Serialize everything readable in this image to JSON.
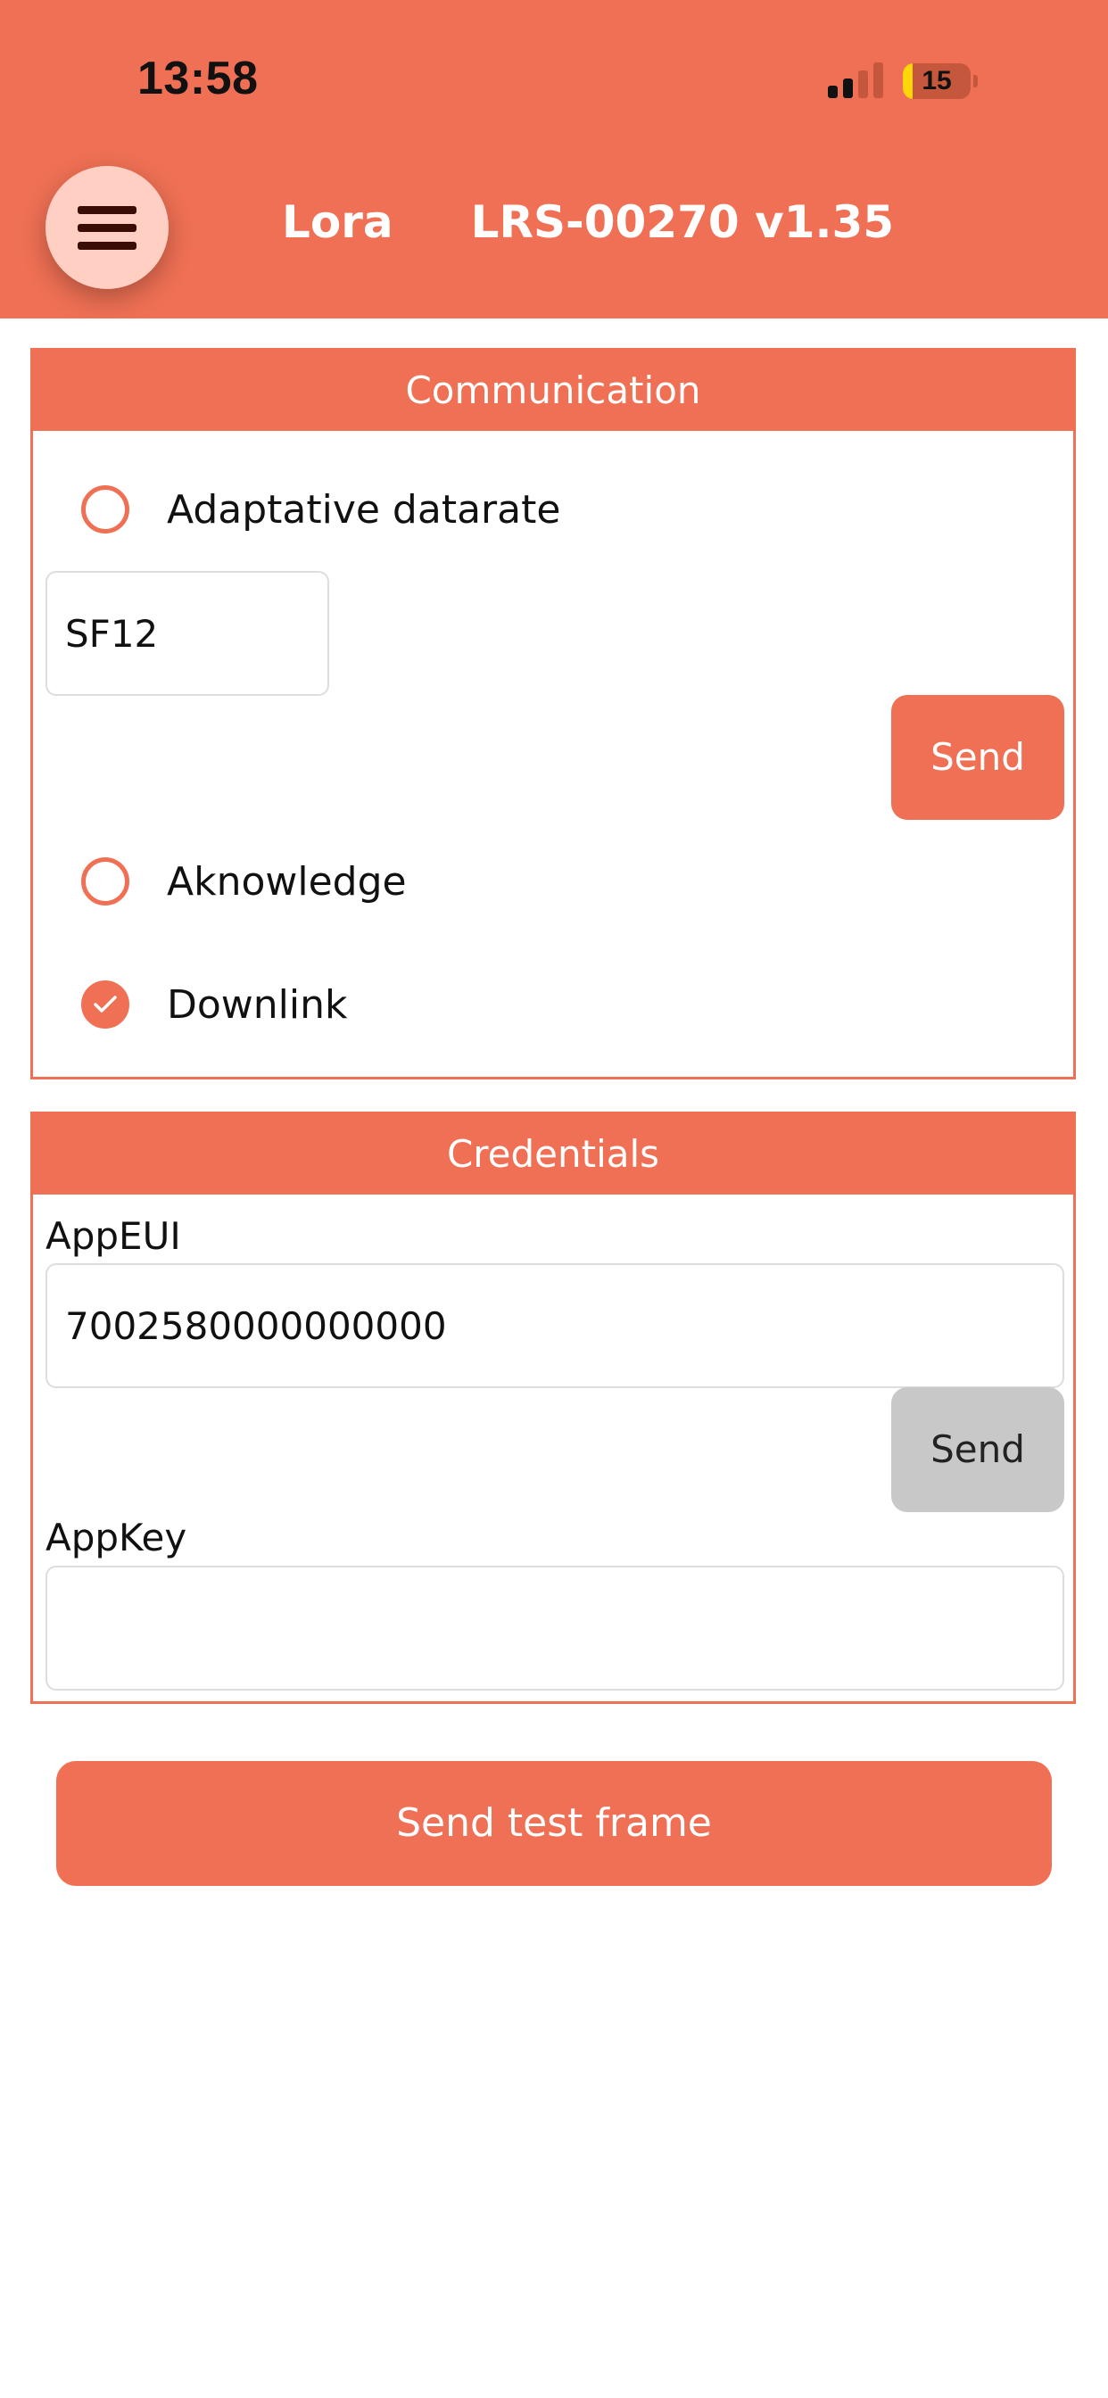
{
  "status_bar": {
    "time": "13:58",
    "battery_level": "15",
    "battery_fraction": 0.15
  },
  "header": {
    "title": "Lora     LRS-00270 v1.35",
    "menu_icon": "hamburger-menu-icon"
  },
  "communication": {
    "title": "Communication",
    "adaptive_datarate_label": "Adaptative datarate",
    "adaptive_datarate_checked": false,
    "spreading_factor_value": "SF12",
    "send_label": "Send",
    "acknowledge_label": "Aknowledge",
    "acknowledge_checked": false,
    "downlink_label": "Downlink",
    "downlink_checked": true
  },
  "credentials": {
    "title": "Credentials",
    "appeui_label": "AppEUI",
    "appeui_value": "7002580000000000",
    "send_label": "Send",
    "appkey_label": "AppKey",
    "appkey_value": ""
  },
  "actions": {
    "send_test_frame_label": "Send test frame"
  },
  "colors": {
    "accent": "#ef7054",
    "menu_button_bg": "#ffcfc3",
    "disabled_button": "#c8c8c8"
  }
}
